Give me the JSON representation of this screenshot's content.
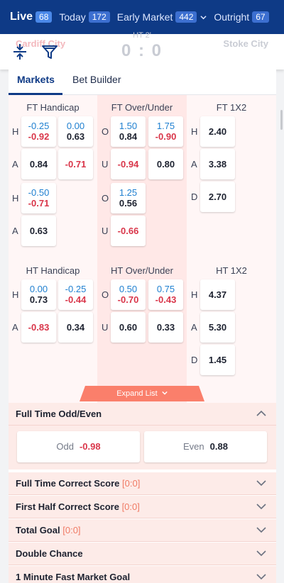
{
  "nav": {
    "live": {
      "label": "Live",
      "count": "68"
    },
    "today": {
      "label": "Today",
      "count": "172"
    },
    "early": {
      "label": "Early Market",
      "count": "442"
    },
    "outright": {
      "label": "Outright",
      "count": "67"
    }
  },
  "match": {
    "home": "Cardiff City",
    "away": "Stoke City",
    "time": "HT 2'",
    "score": "0 : 0"
  },
  "tabs": {
    "markets": "Markets",
    "bet_builder": "Bet Builder"
  },
  "ft": {
    "handicap_title": "FT Handicap",
    "ou_title": "FT Over/Under",
    "x12_title": "FT 1X2",
    "hdp": [
      {
        "h_line": "-0.25",
        "h_odds": "-0.92",
        "a_odds": "0.84"
      },
      {
        "h_line": "0.00",
        "h_odds": "0.63",
        "a_odds": "-0.71"
      },
      {
        "h_line": "-0.50",
        "h_odds": "-0.71",
        "a_odds": "0.63"
      }
    ],
    "ou": [
      {
        "line": "1.50",
        "o_odds": "0.84",
        "u_odds": "-0.94"
      },
      {
        "line": "1.75",
        "o_odds": "-0.90",
        "u_odds": "0.80"
      },
      {
        "line": "1.25",
        "o_odds": "0.56",
        "u_odds": "-0.66"
      }
    ],
    "x12": {
      "h": "2.40",
      "a": "3.38",
      "d": "2.70"
    }
  },
  "ht": {
    "handicap_title": "HT Handicap",
    "ou_title": "HT Over/Under",
    "x12_title": "HT 1X2",
    "hdp": [
      {
        "h_line": "0.00",
        "h_odds": "0.73",
        "a_odds": "-0.83"
      },
      {
        "h_line": "-0.25",
        "h_odds": "-0.44",
        "a_odds": "0.34"
      }
    ],
    "ou": [
      {
        "line": "0.50",
        "o_odds": "-0.70",
        "u_odds": "0.60"
      },
      {
        "line": "0.75",
        "o_odds": "-0.43",
        "u_odds": "0.33"
      }
    ],
    "x12": {
      "h": "4.37",
      "a": "5.30",
      "d": "1.45"
    }
  },
  "labels": {
    "h": "H",
    "a": "A",
    "o": "O",
    "u": "U",
    "d": "D"
  },
  "expand_label": "Expand List",
  "odd_even": {
    "title": "Full Time Odd/Even",
    "odd_label": "Odd",
    "odd_value": "-0.98",
    "even_label": "Even",
    "even_value": "0.88"
  },
  "sections": [
    {
      "title": "Full Time Correct Score",
      "score": "[0:0]"
    },
    {
      "title": "First Half Correct Score",
      "score": "[0:0]"
    },
    {
      "title": "Total Goal",
      "score": "[0:0]"
    },
    {
      "title": "Double Chance",
      "score": ""
    },
    {
      "title": "1 Minute Fast Market Goal",
      "score": ""
    }
  ],
  "colors": {
    "nav_bg": "#0e3a86",
    "negative": "#d9364a",
    "line_blue": "#1e7fd0",
    "accent": "#fa7f6b"
  }
}
